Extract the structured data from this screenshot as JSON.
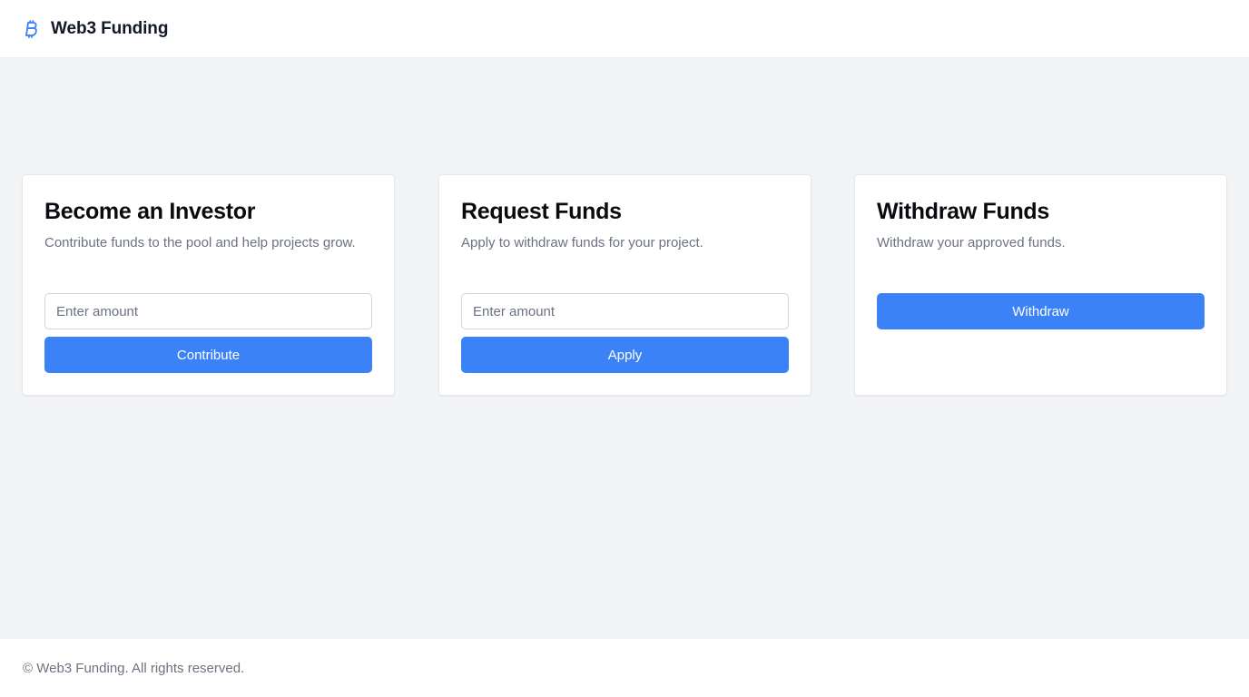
{
  "header": {
    "logo_icon": "bitcoin-icon",
    "brand": "Web3 Funding",
    "accent_color": "#3b82f6"
  },
  "cards": {
    "investor": {
      "title": "Become an Investor",
      "description": "Contribute funds to the pool and help projects grow.",
      "input_placeholder": "Enter amount",
      "input_value": "",
      "button_label": "Contribute"
    },
    "request": {
      "title": "Request Funds",
      "description": "Apply to withdraw funds for your project.",
      "input_placeholder": "Enter amount",
      "input_value": "",
      "button_label": "Apply"
    },
    "withdraw": {
      "title": "Withdraw Funds",
      "description": "Withdraw your approved funds.",
      "button_label": "Withdraw"
    }
  },
  "footer": {
    "text": "© Web3 Funding. All rights reserved."
  }
}
